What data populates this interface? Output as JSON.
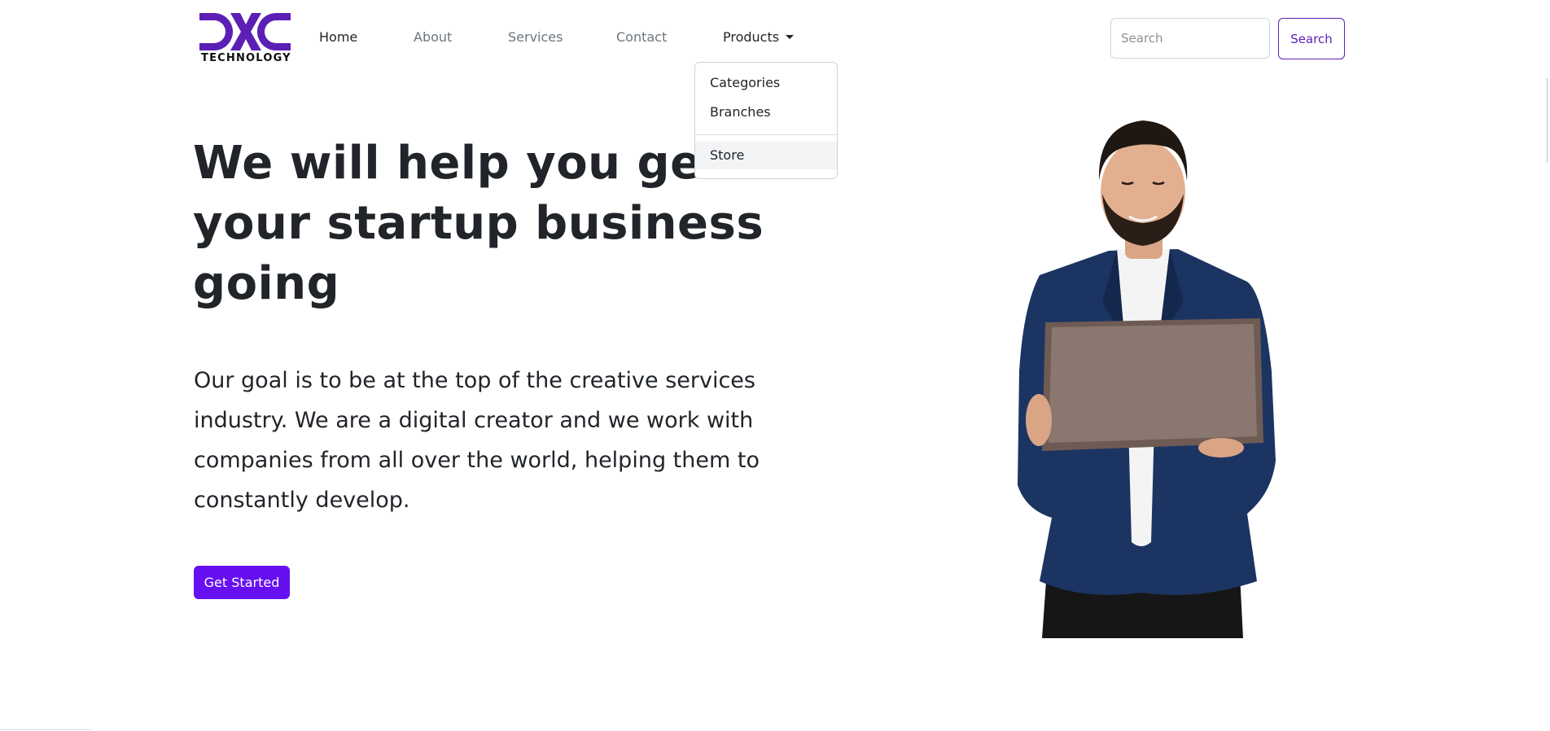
{
  "brand": {
    "wordmark": "DXC",
    "tagline": "TECHNOLOGY",
    "color": "#5c1fb6"
  },
  "nav": {
    "links": [
      {
        "label": "Home",
        "active": true
      },
      {
        "label": "About"
      },
      {
        "label": "Services"
      },
      {
        "label": "Contact"
      },
      {
        "label": "Products",
        "dropdown": true,
        "open": true
      }
    ]
  },
  "search": {
    "placeholder": "Search",
    "button_label": "Search"
  },
  "products_menu": {
    "items": [
      "Categories",
      "Branches"
    ],
    "after_divider": [
      "Store"
    ],
    "hovered": "Store"
  },
  "hero": {
    "title": "We will help you get your startup business going",
    "description": "Our goal is to be at the top of the creative services industry. We are a digital creator and we work with companies from all over the world, helping them to constantly develop.",
    "cta_label": "Get Started",
    "cta_color": "#6610f2",
    "image": "man-with-laptop"
  }
}
